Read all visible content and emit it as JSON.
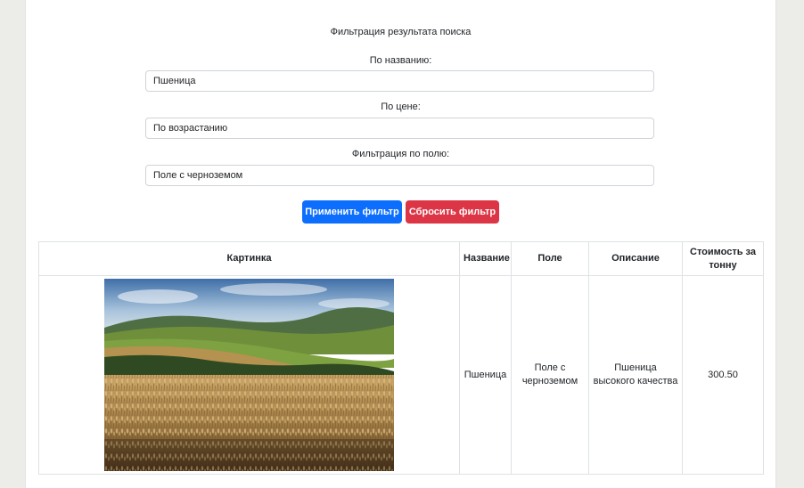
{
  "filter": {
    "title": "Фильтрация результата поиска",
    "name_label": "По названию:",
    "name_value": "Пшеница",
    "price_label": "По цене:",
    "price_value": "По возрастанию",
    "field_label": "Фильтрация по полю:",
    "field_value": "Поле с черноземом",
    "apply_label": "Применить фильтр",
    "reset_label": "Сбросить фильтр",
    "colors": {
      "apply": "#0d6efd",
      "reset": "#dc3545"
    }
  },
  "table": {
    "headers": [
      "Картинка",
      "Название",
      "Поле",
      "Описание",
      "Стоимость за тонну"
    ],
    "rows": [
      {
        "image": "wheat-field-photo",
        "name": "Пшеница",
        "field": "Поле с черноземом",
        "description": "Пшеница высокого качества",
        "price": "300.50"
      }
    ]
  }
}
